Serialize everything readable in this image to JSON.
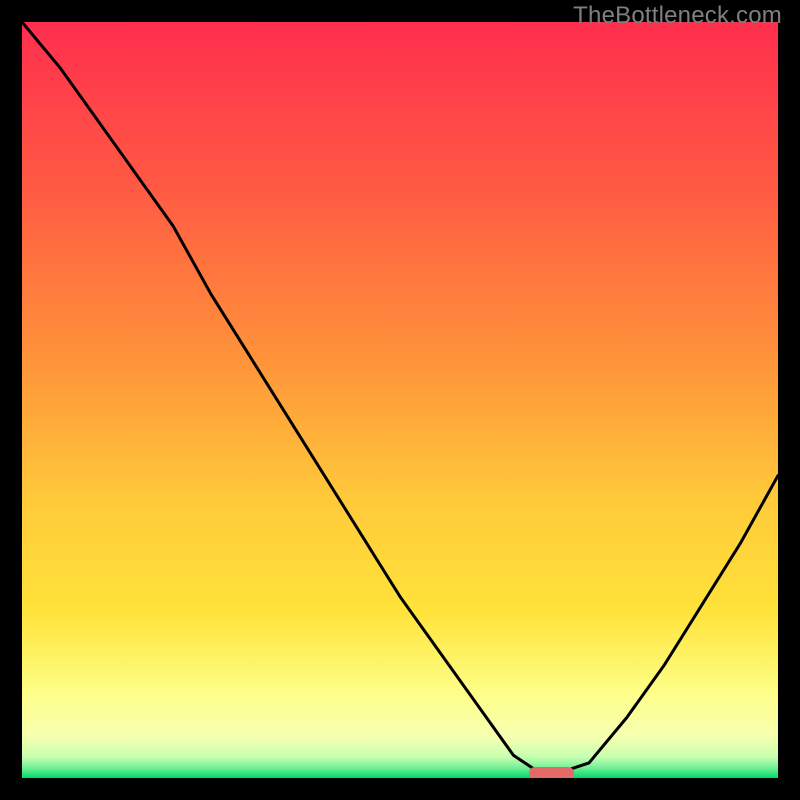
{
  "watermark": "TheBottleneck.com",
  "colors": {
    "gradient_top": "#ff2e4e",
    "gradient_mid_orange": "#ff7a3a",
    "gradient_mid_yellow": "#ffd83a",
    "gradient_pale_yellow": "#feff9a",
    "gradient_bottom": "#00d96b",
    "curve": "#000000",
    "marker": "#e46a6a",
    "frame": "#000000"
  },
  "chart_data": {
    "type": "line",
    "title": "",
    "xlabel": "",
    "ylabel": "",
    "xlim": [
      0,
      100
    ],
    "ylim": [
      0,
      100
    ],
    "grid": false,
    "legend_position": "none",
    "series": [
      {
        "name": "bottleneck-curve",
        "x": [
          0,
          5,
          10,
          15,
          20,
          25,
          30,
          35,
          40,
          45,
          50,
          55,
          60,
          65,
          68,
          72,
          75,
          80,
          85,
          90,
          95,
          100
        ],
        "values": [
          100,
          94,
          87,
          80,
          73,
          64,
          56,
          48,
          40,
          32,
          24,
          17,
          10,
          3,
          1,
          1,
          2,
          8,
          15,
          23,
          31,
          40
        ]
      }
    ],
    "annotations": [
      {
        "name": "optimal-marker",
        "x_start": 67,
        "x_end": 73,
        "y": 0.6
      }
    ],
    "background_gradient_stops": [
      {
        "offset": 0.0,
        "color": "#ff2e4e"
      },
      {
        "offset": 0.22,
        "color": "#ff5a43"
      },
      {
        "offset": 0.45,
        "color": "#ff943a"
      },
      {
        "offset": 0.63,
        "color": "#ffc93a"
      },
      {
        "offset": 0.78,
        "color": "#ffe33a"
      },
      {
        "offset": 0.89,
        "color": "#feff8a"
      },
      {
        "offset": 0.945,
        "color": "#f6ffb0"
      },
      {
        "offset": 0.972,
        "color": "#c8ffb0"
      },
      {
        "offset": 0.985,
        "color": "#7df29a"
      },
      {
        "offset": 1.0,
        "color": "#00d96b"
      }
    ]
  }
}
